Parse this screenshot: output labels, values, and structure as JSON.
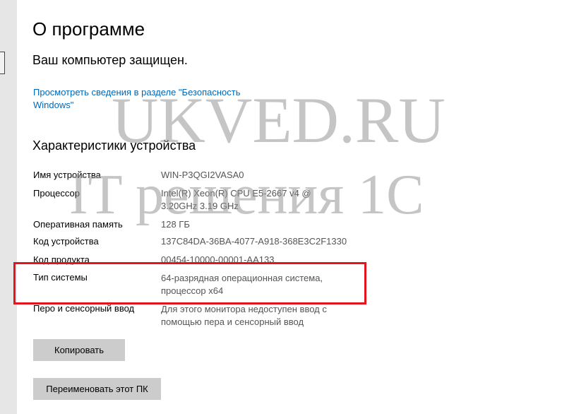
{
  "page": {
    "title": "О программе",
    "protected_status": "Ваш компьютер защищен.",
    "security_link": "Просмотреть сведения в разделе \"Безопасность Windows\""
  },
  "device_specs": {
    "section_title": "Характеристики устройства",
    "rows": [
      {
        "label": "Имя устройства",
        "value": "WIN-P3QGI2VASA0"
      },
      {
        "label": "Процессор",
        "value": "Intel(R) Xeon(R) CPU E5-2667 v4 @ 3.20GHz   3.19 GHz"
      },
      {
        "label": "Оперативная память",
        "value": "128 ГБ"
      },
      {
        "label": "Код устройства",
        "value": "137C84DA-36BA-4077-A918-368E3C2F1330"
      },
      {
        "label": "Код продукта",
        "value": "00454-10000-00001-AA133"
      },
      {
        "label": "Тип системы",
        "value": "64-разрядная операционная система, процессор x64"
      },
      {
        "label": "Перо и сенсорный ввод",
        "value": "Для этого монитора недоступен ввод с помощью пера и сенсорный ввод"
      }
    ]
  },
  "buttons": {
    "copy": "Копировать",
    "rename": "Переименовать этот ПК"
  },
  "watermark": {
    "line1": "UKVED.RU",
    "line2": "IT решения 1С"
  },
  "colors": {
    "link": "#0067b8",
    "highlight_border": "#e3141e",
    "button_bg": "#cccccc",
    "value_text": "#555555"
  }
}
